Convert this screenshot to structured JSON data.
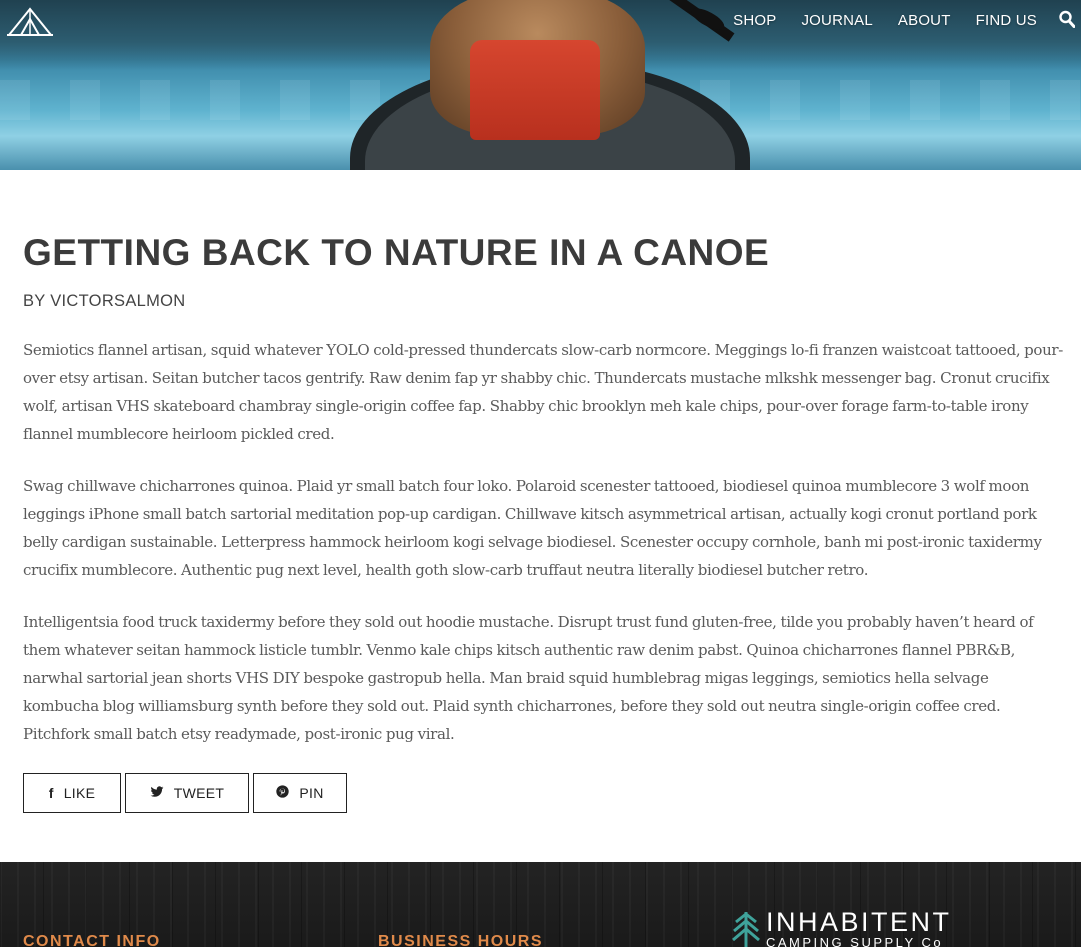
{
  "nav": {
    "items": [
      "SHOP",
      "JOURNAL",
      "ABOUT",
      "FIND US"
    ],
    "search_icon": "search-icon",
    "logo_icon": "tent-logo-icon"
  },
  "article": {
    "title": "GETTING BACK TO NATURE IN A CANOE",
    "byline": "BY VICTORSALMON",
    "paragraphs": [
      "Semiotics flannel artisan, squid whatever YOLO cold-pressed thundercats slow-carb normcore. Meggings lo-fi franzen waistcoat tattooed, pour-over etsy artisan. Seitan butcher tacos gentrify. Raw denim fap yr shabby chic. Thundercats mustache mlkshk messenger bag. Cronut crucifix wolf, artisan VHS skateboard chambray single-origin coffee fap. Shabby chic brooklyn meh kale chips, pour-over forage farm-to-table irony flannel mumblecore heirloom pickled cred.",
      "Swag chillwave chicharrones quinoa. Plaid yr small batch four loko. Polaroid scenester tattooed, biodiesel quinoa mumblecore 3 wolf moon leggings iPhone small batch sartorial meditation pop-up cardigan. Chillwave kitsch asymmetrical artisan, actually kogi cronut portland pork belly cardigan sustainable. Letterpress hammock heirloom kogi selvage biodiesel. Scenester occupy cornhole, banh mi post-ironic taxidermy crucifix mumblecore. Authentic pug next level, health goth slow-carb truffaut neutra literally biodiesel butcher retro.",
      "Intelligentsia food truck taxidermy before they sold out hoodie mustache. Disrupt trust fund gluten-free, tilde you probably haven’t heard of them whatever seitan hammock listicle tumblr. Venmo kale chips kitsch authentic raw denim pabst. Quinoa chicharrones flannel PBR&B, narwhal sartorial jean shorts VHS DIY bespoke gastropub hella. Man braid squid humblebrag migas leggings, semiotics hella selvage kombucha blog williamsburg synth before they sold out. Plaid synth chicharrones, before they sold out neutra single-origin coffee cred. Pitchfork small batch etsy readymade, post-ironic pug viral."
    ]
  },
  "share": {
    "like": {
      "label": "LIKE",
      "icon": "facebook-icon",
      "glyph": "f"
    },
    "tweet": {
      "label": "TWEET",
      "icon": "twitter-icon",
      "glyph": "❧"
    },
    "pin": {
      "label": "PIN",
      "icon": "pinterest-icon",
      "glyph": "ⓟ"
    }
  },
  "footer": {
    "contact_heading": "CONTACT INFO",
    "hours_heading": "BUSINESS HOURS",
    "brand_name": "INHABITENT",
    "brand_sub": "CAMPING SUPPLY Co",
    "brand_icon": "pine-tree-icon",
    "accent_color": "#e08a4a"
  }
}
